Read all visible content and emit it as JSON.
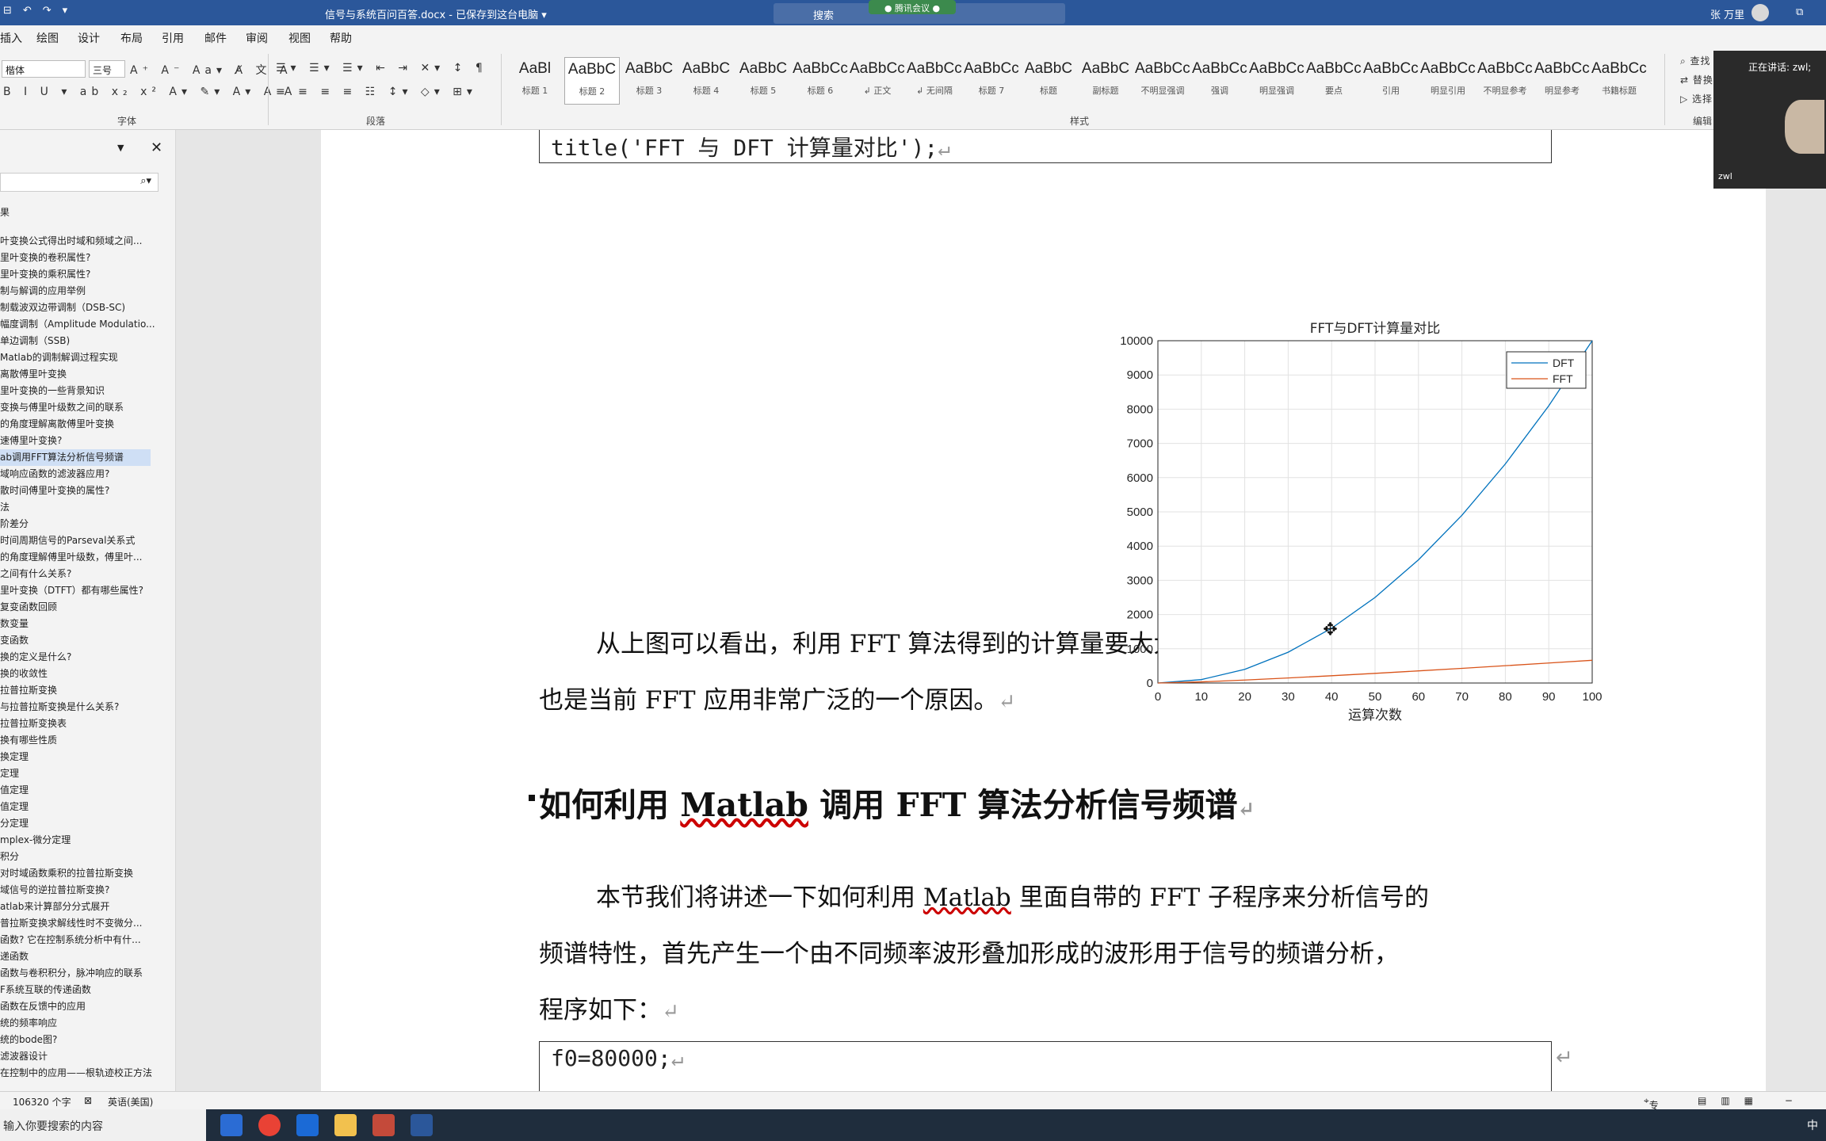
{
  "titlebar": {
    "doc_title": "信号与系统百问百答.docx - 已保存到这台电脑 ▾",
    "search_placeholder": "搜索",
    "meeting_badge": "● 腾讯会议 ●",
    "user_name": "张 万里",
    "qat_icons": "⊟↶↷▾",
    "restore_icon": "⧉"
  },
  "menu": [
    "插入",
    "绘图",
    "设计",
    "布局",
    "引用",
    "邮件",
    "审阅",
    "视图",
    "帮助"
  ],
  "ribbon": {
    "font_name": "楷体",
    "font_size": "三号",
    "group_font": "字体",
    "group_paragraph": "段落",
    "group_styles": "样式",
    "group_editing": "编辑",
    "font_row1_icons": "A⁺ A⁻ Aa▾ A̸ 文 A",
    "font_row2_icons": "B I U ▾ ab x₂ x² A▾ ✎▾ A▾ A A",
    "para_row1_icons": "☰▾ ☰▾ ☰▾ ⇤ ⇥ ✕▾ ↕ ¶",
    "para_row2_icons": "≡ ≡ ≡ ≡ ☷ ↕▾ ◇▾ ⊞▾",
    "find": "查找",
    "replace": "替换",
    "select": "选择",
    "styles": [
      {
        "preview": "AaBl",
        "name": "标题 1"
      },
      {
        "preview": "AaBbC",
        "name": "标题 2"
      },
      {
        "preview": "AaBbC",
        "name": "标题 3"
      },
      {
        "preview": "AaBbC",
        "name": "标题 4"
      },
      {
        "preview": "AaBbC",
        "name": "标题 5"
      },
      {
        "preview": "AaBbCc",
        "name": "标题 6"
      },
      {
        "preview": "AaBbCcD",
        "name": "↲ 正文"
      },
      {
        "preview": "AaBbCcD",
        "name": "↲ 无间隔"
      },
      {
        "preview": "AaBbCcl",
        "name": "标题 7"
      },
      {
        "preview": "AaBbC",
        "name": "标题"
      },
      {
        "preview": "AaBbC",
        "name": "副标题"
      },
      {
        "preview": "AaBbCcD",
        "name": "不明显强调"
      },
      {
        "preview": "AaBbCcD",
        "name": "强调"
      },
      {
        "preview": "AaBbCcD",
        "name": "明显强调"
      },
      {
        "preview": "AaBbCcD",
        "name": "要点"
      },
      {
        "preview": "AaBbCcD",
        "name": "引用"
      },
      {
        "preview": "AaBbCcD",
        "name": "明显引用"
      },
      {
        "preview": "AaBbCcD",
        "name": "不明显参考"
      },
      {
        "preview": "AaBbCcD",
        "name": "明显参考"
      },
      {
        "preview": "AaBbCcD",
        "name": "书籍标题"
      }
    ]
  },
  "nav": {
    "header_partial": "果",
    "items": [
      "叶变换公式得出时域和频域之间...",
      "里叶变换的卷积属性?",
      "里叶变换的乘积属性?",
      "制与解调的应用举例",
      "制载波双边带调制（DSB-SC)",
      "幅度调制（Amplitude Modulatio...",
      "单边调制（SSB)",
      "Matlab的调制解调过程实现",
      "离散傅里叶变换",
      "里叶变换的一些背景知识",
      "变换与傅里叶级数之间的联系",
      "的角度理解离散傅里叶变换",
      "速傅里叶变换?",
      "ab调用FFT算法分析信号频谱",
      "域响应函数的滤波器应用?",
      "散时间傅里叶变换的属性?",
      "法",
      "阶差分",
      "时间周期信号的Parseval关系式",
      "的角度理解傅里叶级数，傅里叶...",
      "之间有什么关系?",
      "里叶变换（DTFT）都有哪些属性?",
      "复变函数回顾",
      "数变量",
      "变函数",
      "换的定义是什么?",
      "换的收敛性",
      "拉普拉斯变换",
      "与拉普拉斯变换是什么关系?",
      "拉普拉斯变换表",
      "换有哪些性质",
      "换定理",
      "定理",
      "值定理",
      "值定理",
      "分定理",
      "mplex-微分定理",
      "积分",
      "对时域函数乘积的拉普拉斯变换",
      "域信号的逆拉普拉斯变换?",
      "atlab来计算部分分式展开",
      "普拉斯变换求解线性时不变微分...",
      "函数? 它在控制系统分析中有什...",
      "递函数",
      "函数与卷积积分，脉冲响应的联系",
      "F系统互联的传递函数",
      "函数在反馈中的应用",
      "统的频率响应",
      "统的bode图?",
      "滤波器设计",
      "在控制中的应用——根轨迹校正方法"
    ],
    "selected_index": 13
  },
  "document": {
    "code_top": "title('FFT 与 DFT 计算量对比');",
    "paragraph1_line1": "从上图可以看出，利用 FFT 算法得到的计算量要大大减少 DFT 的计算量，这",
    "paragraph1_line2": "也是当前 FFT 应用非常广泛的一个原因。",
    "heading_pre": "如何利用 ",
    "heading_wavy": "Matlab",
    "heading_post": " 调用 FFT 算法分析信号频谱",
    "paragraph2_line1_pre": "本节我们将讲述一下如何利用 ",
    "paragraph2_line1_wavy": "Matlab",
    "paragraph2_line1_post": " 里面自带的 FFT 子程序来分析信号的",
    "paragraph2_line2": "频谱特性，首先产生一个由不同频率波形叠加形成的波形用于信号的频谱分析，",
    "paragraph2_line3": "程序如下：",
    "code_bottom": "f0=80000;",
    "return_mark": "↵"
  },
  "chart_data": {
    "type": "line",
    "title": "FFT与DFT计算量对比",
    "xlabel": "运算次数",
    "ylabel": "",
    "xlim": [
      0,
      100
    ],
    "ylim": [
      0,
      10000
    ],
    "xticks": [
      0,
      10,
      20,
      30,
      40,
      50,
      60,
      70,
      80,
      90,
      100
    ],
    "yticks": [
      0,
      1000,
      2000,
      3000,
      4000,
      5000,
      6000,
      7000,
      8000,
      9000,
      10000
    ],
    "grid": true,
    "legend_position": "top-right",
    "x": [
      0,
      10,
      20,
      30,
      40,
      50,
      60,
      70,
      80,
      90,
      100
    ],
    "series": [
      {
        "name": "DFT",
        "color": "#0072bd",
        "values": [
          0,
          100,
          400,
          900,
          1600,
          2500,
          3600,
          4900,
          6400,
          8100,
          10000
        ]
      },
      {
        "name": "FFT",
        "color": "#d95319",
        "values": [
          0,
          33,
          86,
          147,
          213,
          282,
          354,
          429,
          506,
          584,
          664
        ]
      }
    ]
  },
  "status": {
    "word_count": "106320 个字",
    "language": "英语(美国)",
    "focus": "专注"
  },
  "taskbar": {
    "search": "输入你要搜索的内容",
    "ime": "中"
  },
  "video": {
    "speaking": "正在讲话: zwl;",
    "participant": "zwl"
  }
}
